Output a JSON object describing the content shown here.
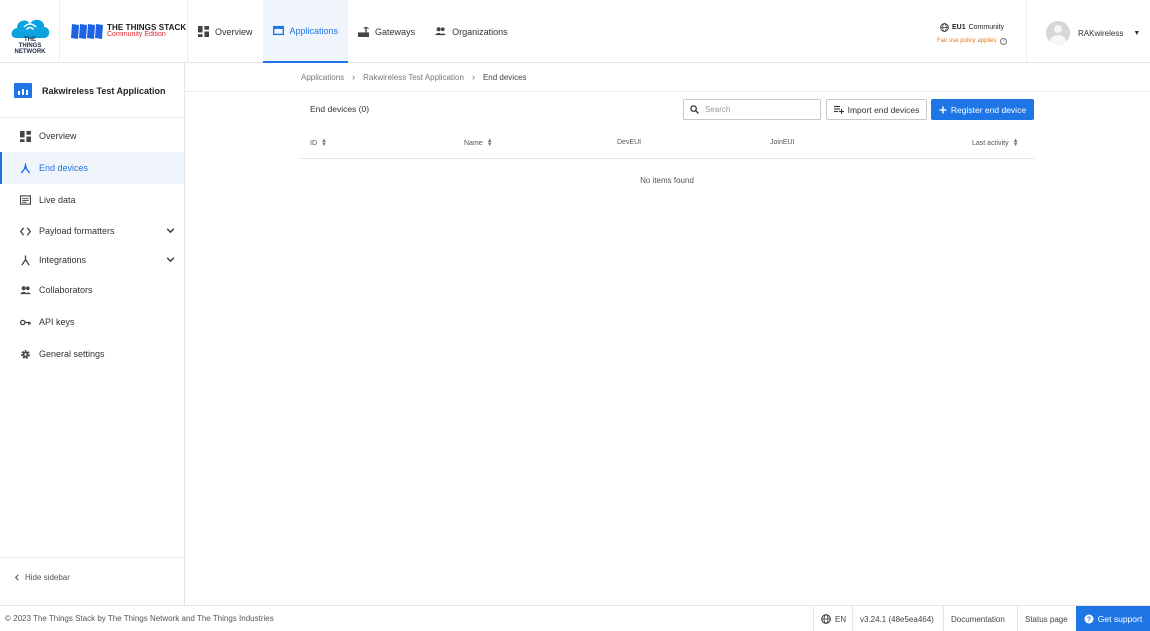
{
  "header": {
    "ttn_logo_text": "THE THINGS NETWORK",
    "stack_title": "THE THINGS STACK",
    "stack_subtitle": "Community Edition",
    "nav": [
      {
        "label": "Overview",
        "icon": "dashboard-icon"
      },
      {
        "label": "Applications",
        "icon": "application-icon",
        "active": true
      },
      {
        "label": "Gateways",
        "icon": "gateway-icon"
      },
      {
        "label": "Organizations",
        "icon": "organization-icon"
      }
    ],
    "region": {
      "cluster": "EU1",
      "name": "Community",
      "notice": "Fair use policy applies"
    },
    "user": {
      "name": "RAKwireless"
    }
  },
  "sidebar": {
    "app_name": "Rakwireless Test Application",
    "items": [
      {
        "label": "Overview",
        "icon": "dashboard-icon"
      },
      {
        "label": "End devices",
        "icon": "end-device-icon",
        "active": true
      },
      {
        "label": "Live data",
        "icon": "live-data-icon"
      },
      {
        "label": "Payload formatters",
        "icon": "code-icon",
        "expandable": true
      },
      {
        "label": "Integrations",
        "icon": "integration-icon",
        "expandable": true
      },
      {
        "label": "Collaborators",
        "icon": "people-icon"
      },
      {
        "label": "API keys",
        "icon": "key-icon"
      },
      {
        "label": "General settings",
        "icon": "gear-icon"
      }
    ],
    "hide_label": "Hide sidebar"
  },
  "breadcrumbs": [
    "Applications",
    "Rakwireless Test Application",
    "End devices"
  ],
  "main": {
    "title": "End devices (0)",
    "search_placeholder": "Search",
    "import_label": "Import end devices",
    "register_label": "Register end device",
    "columns": [
      "ID",
      "Name",
      "DevEUI",
      "JoinEUI",
      "Last activity"
    ],
    "empty_text": "No items found"
  },
  "footer": {
    "copyright": "© 2023 The Things Stack by The Things Network and The Things Industries",
    "language": "EN",
    "version": "v3.24.1 (48e5ea464)",
    "documentation": "Documentation",
    "status": "Status page",
    "support": "Get support"
  },
  "colors": {
    "accent": "#1e75e6",
    "warning": "#e07a1f",
    "brand_red": "#e3212d"
  }
}
